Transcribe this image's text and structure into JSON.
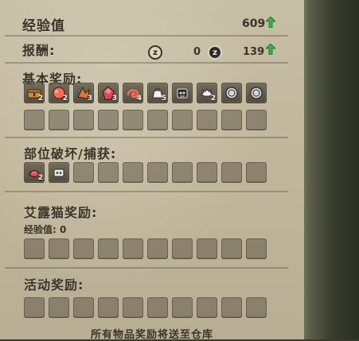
{
  "header": {
    "exp_label": "经验值",
    "exp_value": "609",
    "reward_label": "报酬:",
    "reward_zenny": "0",
    "reward_points": "139"
  },
  "sections": {
    "basic_rewards_title": "基本奖励:",
    "part_break_title": "部位破坏/捕获:",
    "palico_title": "艾露猫奖励:",
    "palico_exp": "经验值: 0",
    "event_title": "活动奖励:"
  },
  "basic_rewards": {
    "row1": [
      {
        "icon": "chest-icon",
        "qty": "2"
      },
      {
        "icon": "orange-egg-icon",
        "qty": "2"
      },
      {
        "icon": "wing-fragment-icon",
        "qty": "3"
      },
      {
        "icon": "ruby-icon",
        "qty": "3"
      },
      {
        "icon": "coiled-tail-icon",
        "qty": "4"
      },
      {
        "icon": "bag-icon",
        "qty": "5"
      },
      {
        "icon": "monster-face-icon",
        "qty": ""
      },
      {
        "icon": "spiky-creature-icon",
        "qty": "2"
      },
      {
        "icon": "coin-icon",
        "qty": ""
      },
      {
        "icon": "coin-icon",
        "qty": ""
      }
    ],
    "row2_count": 10
  },
  "part_break": {
    "items": [
      {
        "icon": "red-part-icon",
        "qty": "2"
      },
      {
        "icon": "material-icon",
        "qty": ""
      }
    ],
    "empty_count": 8
  },
  "palico": {
    "empty_count": 10
  },
  "event": {
    "empty_count": 10
  },
  "footer": {
    "text": "所有物品奖励将送至仓库"
  },
  "colors": {
    "parchment": "#c1b79c",
    "ink": "#3b3428",
    "up_green": "#35b44a",
    "slot_shadow": "#625a4a"
  }
}
